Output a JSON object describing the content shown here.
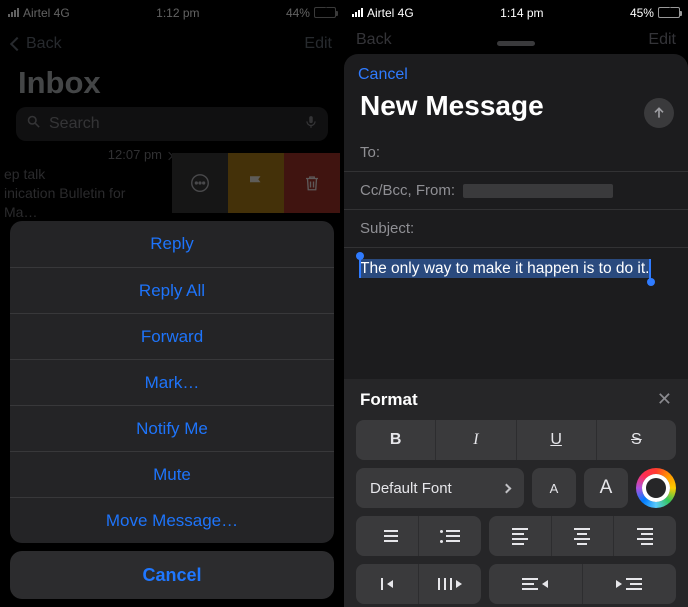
{
  "left": {
    "status": {
      "carrier": "Airtel 4G",
      "time": "1:12 pm",
      "battery_pct": "44%",
      "battery_fill": 44
    },
    "nav": {
      "back": "Back",
      "edit": "Edit"
    },
    "title": "Inbox",
    "search_placeholder": "Search",
    "row": {
      "time": "12:07 pm",
      "line1": "ep talk",
      "line2": "inication Bulletin for Ma…"
    },
    "sheet": {
      "items": [
        "Reply",
        "Reply All",
        "Forward",
        "Mark…",
        "Notify Me",
        "Mute",
        "Move Message…"
      ],
      "cancel": "Cancel"
    }
  },
  "right": {
    "status": {
      "carrier": "Airtel 4G",
      "time": "1:14 pm",
      "battery_pct": "45%",
      "battery_fill": 45
    },
    "behind_nav": {
      "back": "Back",
      "edit": "Edit"
    },
    "compose": {
      "cancel": "Cancel",
      "title": "New Message",
      "to_label": "To:",
      "ccbcc_label": "Cc/Bcc, From:",
      "subject_label": "Subject:",
      "body_selected": "The only way to make it happen is to do it."
    },
    "format": {
      "title": "Format",
      "bold": "B",
      "italic": "I",
      "underline": "U",
      "strike": "S",
      "font": "Default Font",
      "size_small": "A",
      "size_large": "A"
    }
  }
}
